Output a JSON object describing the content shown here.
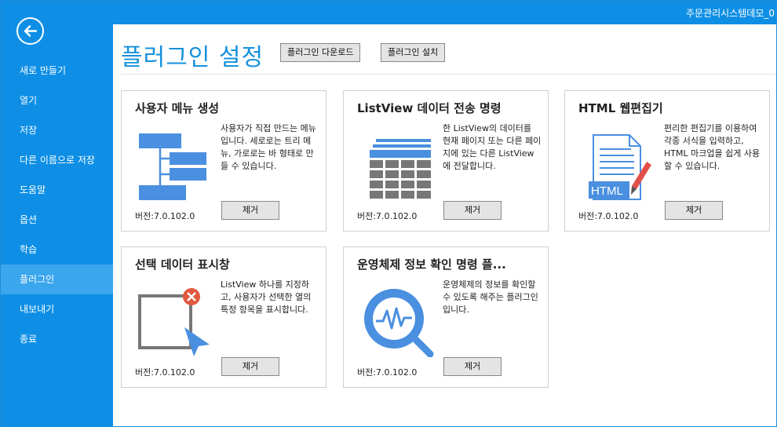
{
  "window": {
    "title": "주문관리시스템데모_0"
  },
  "sidebar": {
    "back_label": "back",
    "items": [
      {
        "label": "새로 만들기",
        "active": false
      },
      {
        "label": "열기",
        "active": false
      },
      {
        "label": "저장",
        "active": false
      },
      {
        "label": "다른 이름으로 저장",
        "active": false
      },
      {
        "label": "도움말",
        "active": false
      },
      {
        "label": "옵션",
        "active": false
      },
      {
        "label": "학습",
        "active": false
      },
      {
        "label": "플러그인",
        "active": true
      },
      {
        "label": "내보내기",
        "active": false
      },
      {
        "label": "종료",
        "active": false
      }
    ]
  },
  "header": {
    "title": "플러그인 설정",
    "download_label": "플러그인 다운로드",
    "install_label": "플러그인 설치"
  },
  "colors": {
    "accent": "#0e8fe5",
    "active_item": "#3aa6ee",
    "title": "#1591dc"
  },
  "plugins": [
    {
      "title": "사용자 메뉴 생성",
      "description": "사용자가 직접 만드는 메뉴입니다. 세로로는 트리 메뉴, 가로로는 바 형태로 만들 수 있습니다.",
      "version": "버전:7.0.102.0",
      "remove_label": "제거",
      "icon": "tree-menu-icon"
    },
    {
      "title": "ListView 데이터 전송 명령",
      "description": "한 ListView의 데이터를 현재 페이지 또는 다른 페이지에 있는 다른 ListView에 전달합니다.",
      "version": "버전:7.0.102.0",
      "remove_label": "제거",
      "icon": "table-grid-icon"
    },
    {
      "title": "HTML 웹편집기",
      "description": "편리한 편집기를 이용하여 각종 서식을 입력하고, HTML 마크업을 쉽게 사용할 수 있습니다.",
      "version": "버전:7.0.102.0",
      "remove_label": "제거",
      "icon": "html-document-icon",
      "icon_text": "HTML"
    },
    {
      "title": "선택 데이터 표시창",
      "description": "ListView 하나를 지정하고, 사용자가 선택한 열의 특정 항목을 표시합니다.",
      "version": "버전:7.0.102.0",
      "remove_label": "제거",
      "icon": "selection-window-icon"
    },
    {
      "title": "운영체제 정보 확인 명령 플...",
      "description": "운영체제의 정보를 확인할 수 있도록 해주는 플러그인입니다.",
      "version": "버전:7.0.102.0",
      "remove_label": "제거",
      "icon": "system-monitor-icon"
    }
  ]
}
